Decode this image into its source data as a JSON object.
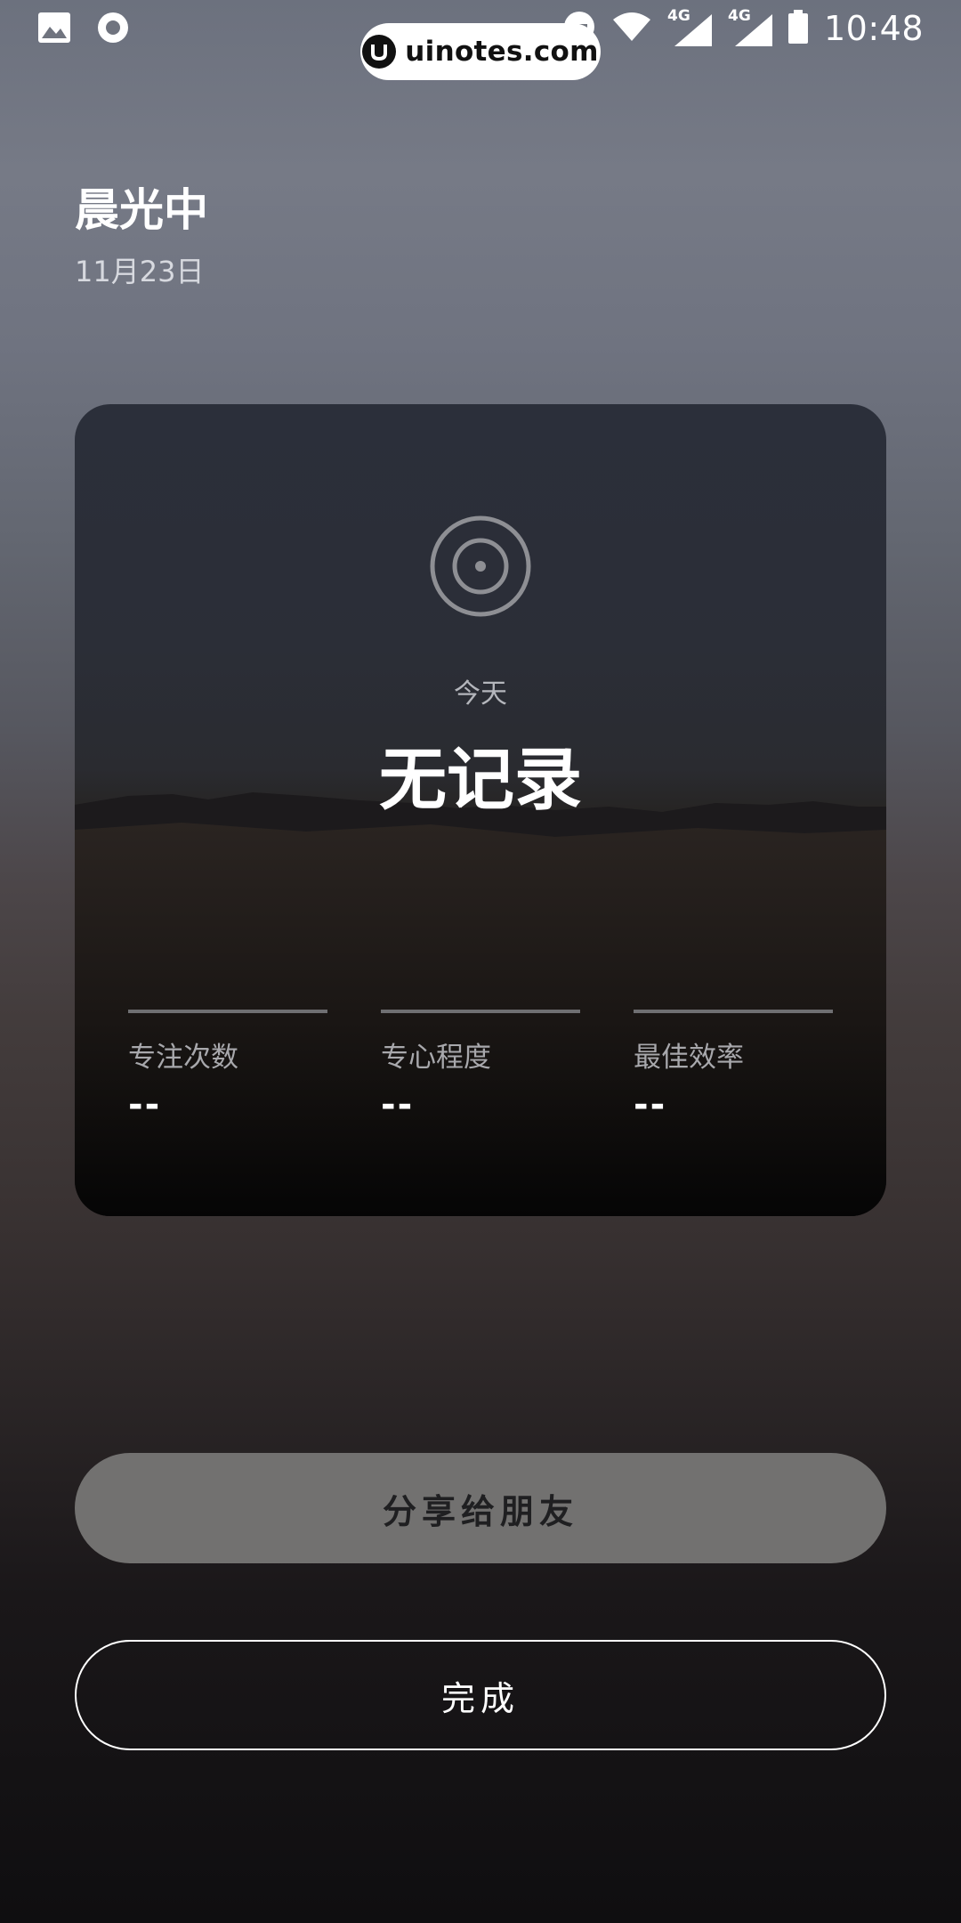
{
  "status_bar": {
    "time": "10:48",
    "network_1": "4G",
    "network_2": "4G",
    "icons": [
      "image-icon",
      "circle-icon",
      "dnd-icon",
      "wifi-icon",
      "signal-icon",
      "signal-icon",
      "battery-icon"
    ]
  },
  "watermark": {
    "text": "uinotes.com"
  },
  "header": {
    "title": "晨光中",
    "date": "11月23日"
  },
  "card": {
    "icon": "target-icon",
    "today_label": "今天",
    "status": "无记录",
    "stats": [
      {
        "label": "专注次数",
        "value": "--"
      },
      {
        "label": "专心程度",
        "value": "--"
      },
      {
        "label": "最佳效率",
        "value": "--"
      }
    ]
  },
  "actions": {
    "share_label": "分享给朋友",
    "done_label": "完成"
  },
  "colors": {
    "share_button_bg": "#727170",
    "card_top": "#2b2f3a",
    "card_bottom": "#070707"
  }
}
